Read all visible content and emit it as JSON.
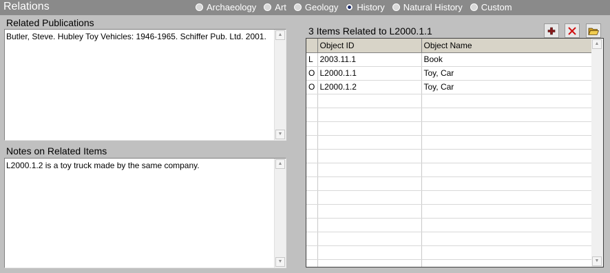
{
  "window": {
    "title": "Relations"
  },
  "disciplines": {
    "options": [
      "Archaeology",
      "Art",
      "Geology",
      "History",
      "Natural History",
      "Custom"
    ],
    "selected": "History"
  },
  "publications": {
    "label": "Related Publications",
    "text": "Butler, Steve. Hubley Toy Vehicles: 1946-1965. Schiffer Pub. Ltd. 2001."
  },
  "notes": {
    "label": "Notes on Related Items",
    "text": "L2000.1.2 is a toy truck made by the same company."
  },
  "related": {
    "heading": "3 Items Related to L2000.1.1",
    "columns": [
      "",
      "Object ID",
      "Object Name"
    ],
    "rows": [
      [
        "L",
        "2003.11.1",
        "Book"
      ],
      [
        "O",
        "L2000.1.1",
        "Toy, Car"
      ],
      [
        "O",
        "L2000.1.2",
        "Toy, Car"
      ]
    ]
  },
  "icons": {
    "add": "plus-icon",
    "delete": "x-icon",
    "open": "folder-open-icon",
    "add_color": "#8a1a1a",
    "delete_color": "#d01010",
    "folder_color": "#e8c040"
  }
}
